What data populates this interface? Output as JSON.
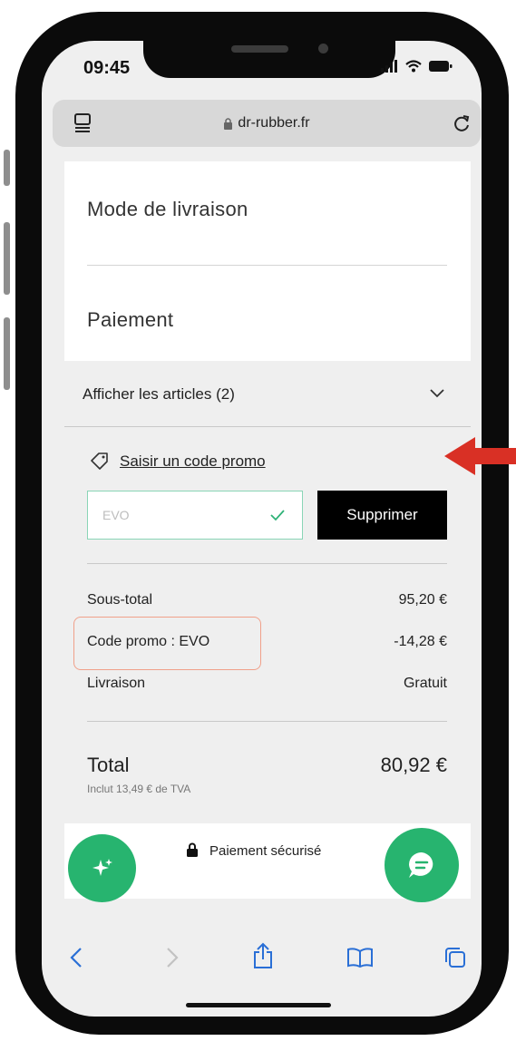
{
  "status": {
    "time": "09:45"
  },
  "browser": {
    "url": "dr-rubber.fr"
  },
  "checkout": {
    "shipping_title": "Mode de livraison",
    "payment_title": "Paiement",
    "show_items_label": "Afficher les articles (2)",
    "promo_link": "Saisir un code promo",
    "promo_value": "EVO",
    "remove_button": "Supprimer",
    "summary": {
      "subtotal_label": "Sous-total",
      "subtotal_value": "95,20 €",
      "promo_label": "Code promo : EVO",
      "promo_value": "-14,28 €",
      "shipping_label": "Livraison",
      "shipping_value": "Gratuit",
      "total_label": "Total",
      "total_value": "80,92 €",
      "vat_note": "Inclut 13,49 € de TVA"
    },
    "secure_payment": "Paiement sécurisé"
  },
  "colors": {
    "annotation_arrow": "#d93025",
    "highlight_box": "#f0a08a",
    "green_button": "#27b46f"
  }
}
